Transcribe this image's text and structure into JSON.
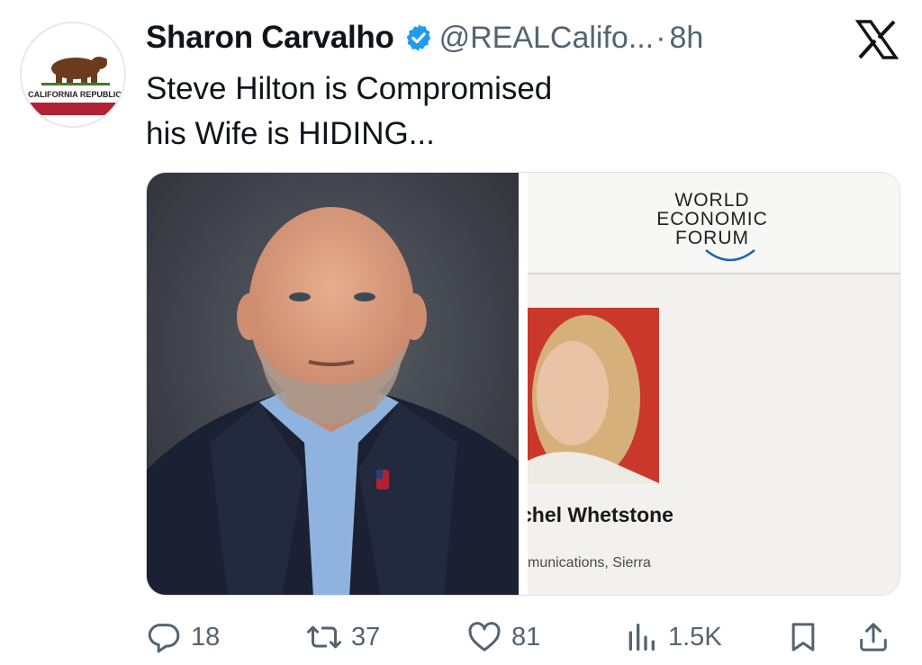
{
  "author": {
    "avatar_text": "CALIFORNIA REPUBLIC",
    "name": "Sharon Carvalho",
    "handle": "@REALCalifo...",
    "separator": "·",
    "time": "8h"
  },
  "tweet": {
    "line1": "Steve Hilton is Compromised",
    "line2": "his Wife is HIDING..."
  },
  "media": {
    "right_logo_lines": [
      "WORLD",
      "ECONOMIC",
      "FORUM"
    ],
    "right_name": "chel Whetstone",
    "right_role": "munications, Sierra"
  },
  "actions": {
    "replies": "18",
    "reposts": "37",
    "likes": "81",
    "views": "1.5K"
  },
  "colors": {
    "text": "#0f1419",
    "secondary": "#536471",
    "verified_blue": "#1d9bf0",
    "wef_blue": "#1e66b1"
  },
  "icons": [
    "verified-badge-icon",
    "x-logo-icon",
    "reply-icon",
    "repost-icon",
    "like-icon",
    "views-icon",
    "bookmark-icon",
    "share-icon"
  ]
}
